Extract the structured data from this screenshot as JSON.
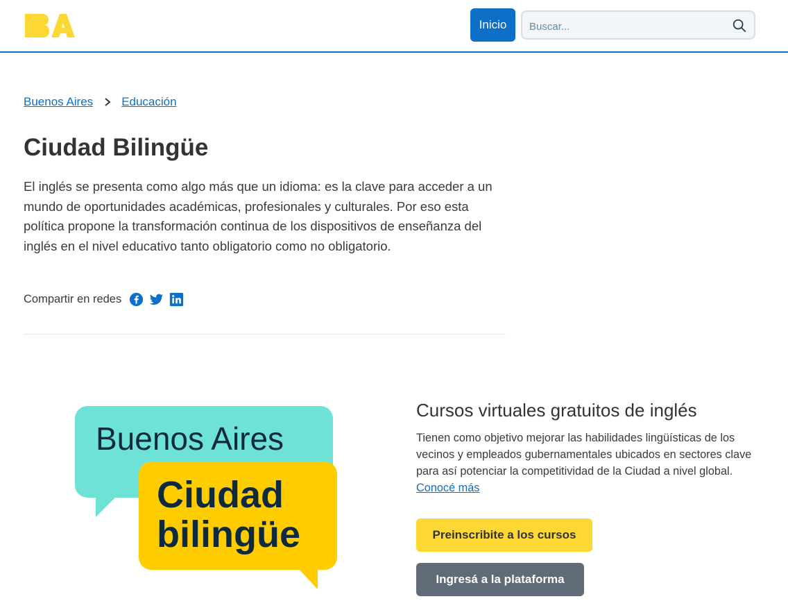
{
  "header": {
    "logo_text": "BA",
    "inicio_label": "Inicio",
    "search_placeholder": "Buscar..."
  },
  "breadcrumb": {
    "items": [
      "Buenos Aires",
      "Educación"
    ]
  },
  "page": {
    "title": "Ciudad Bilingüe",
    "intro": "El inglés se presenta como algo más que un idioma: es la clave para acceder a un mundo de oportunidades académicas, profesionales y culturales. Por eso esta política propone la transformación continua de los dispositivos de enseñanza del inglés en el nivel educativo tanto obligatorio como no obligatorio.",
    "share_label": "Compartir en redes",
    "share_icons": [
      "facebook-icon",
      "twitter-icon",
      "linkedin-icon"
    ]
  },
  "promo_image": {
    "line1": "Buenos Aires",
    "line2": "Ciudad",
    "line3": "bilingüe"
  },
  "card": {
    "title": "Cursos virtuales gratuitos de inglés",
    "body": "Tienen como objetivo mejorar las habilidades lingüísticas de los vecinos y empleados gubernamentales ubicados en sectores clave para así potenciar la competitividad de la Ciudad a nivel global.",
    "link": "Conocé más",
    "button_primary": "Preinscribite a los cursos",
    "button_secondary": "Ingresá a la plataforma"
  },
  "colors": {
    "brand_blue": "#0d6fc7",
    "logo_yellow": "#fdd835",
    "bubble_cyan": "#6ee2d6",
    "bubble_yellow": "#ffcc00",
    "text_dark_navy": "#0f2a3d",
    "button_gray": "#5f6b77"
  }
}
